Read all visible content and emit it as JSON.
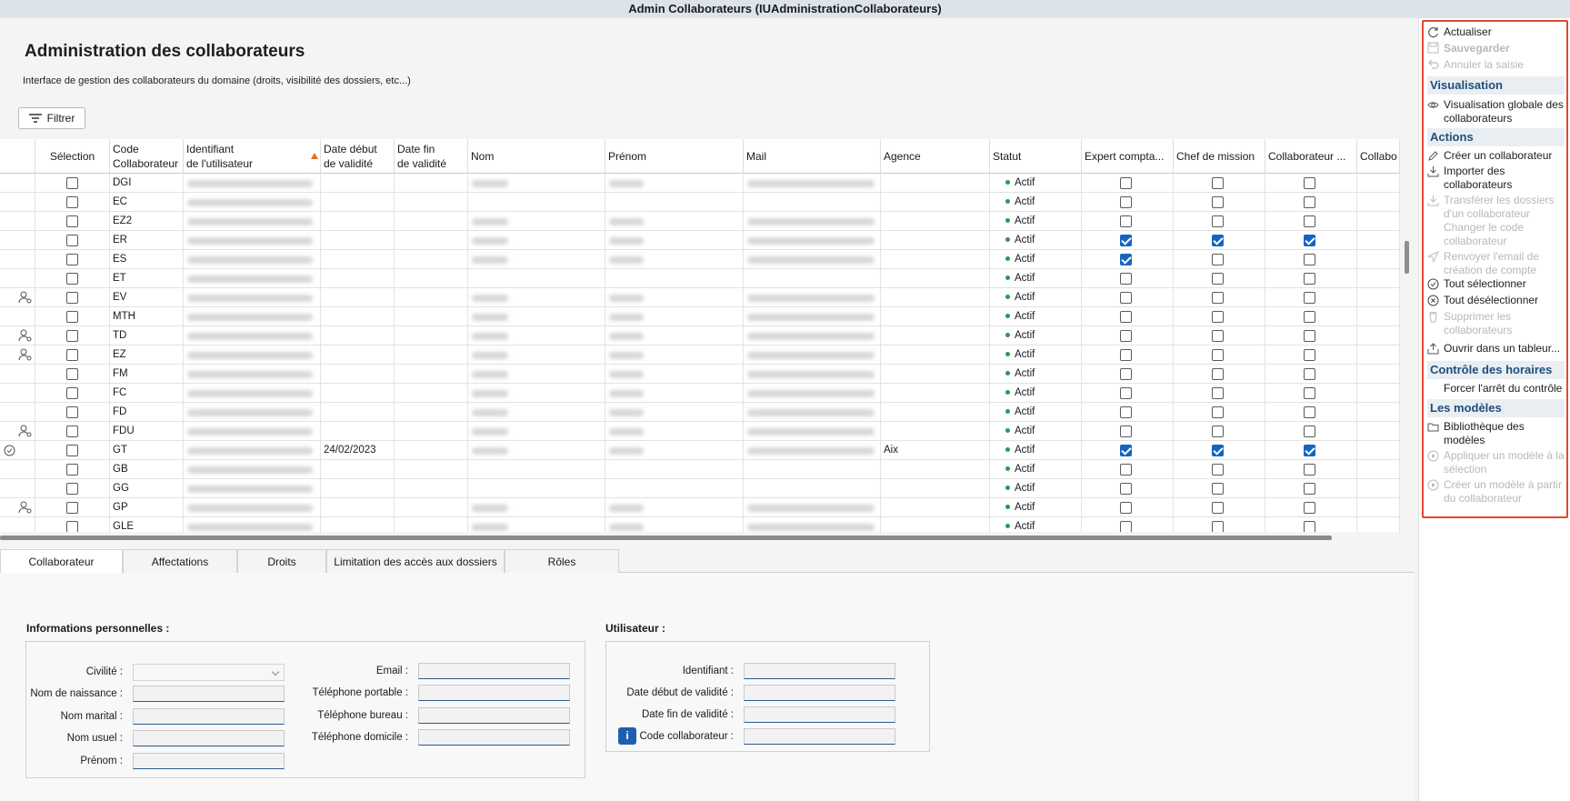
{
  "window_title": "Admin Collaborateurs (IUAdministrationCollaborateurs)",
  "page": {
    "title": "Administration des collaborateurs",
    "subtitle": "Interface de gestion des collaborateurs du domaine (droits, visibilité des dossiers, etc...)",
    "filter_label": "Filtrer"
  },
  "grid": {
    "headers": {
      "selection": "Sélection",
      "code": [
        "Code",
        "Collaborateur"
      ],
      "identifiant": [
        "Identifiant",
        "de l'utilisateur"
      ],
      "debut": [
        "Date début",
        "de validité"
      ],
      "fin": [
        "Date fin",
        "de validité"
      ],
      "nom": "Nom",
      "prenom": "Prénom",
      "mail": "Mail",
      "agence": "Agence",
      "statut": "Statut",
      "expert": "Expert compta...",
      "chef": "Chef de mission",
      "collab": "Collaborateur ...",
      "collab2": "Collabo"
    },
    "rows": [
      {
        "code": "DGI",
        "icon": "",
        "debut": "",
        "agence": "",
        "statut": "Actif",
        "expert": false,
        "chef": false,
        "collab": false
      },
      {
        "code": "EC",
        "icon": "",
        "debut": "",
        "agence": "",
        "statut": "Actif",
        "expert": false,
        "chef": false,
        "collab": false
      },
      {
        "code": "EZ2",
        "icon": "",
        "debut": "",
        "agence": "",
        "statut": "Actif",
        "expert": false,
        "chef": false,
        "collab": false
      },
      {
        "code": "ER",
        "icon": "",
        "debut": "",
        "agence": "",
        "statut": "Actif",
        "expert": true,
        "chef": true,
        "collab": true
      },
      {
        "code": "ES",
        "icon": "",
        "debut": "",
        "agence": "",
        "statut": "Actif",
        "expert": true,
        "chef": false,
        "collab": false
      },
      {
        "code": "ET",
        "icon": "",
        "debut": "",
        "agence": "",
        "statut": "Actif",
        "expert": false,
        "chef": false,
        "collab": false
      },
      {
        "code": "EV",
        "icon": "user",
        "debut": "",
        "agence": "",
        "statut": "Actif",
        "expert": false,
        "chef": false,
        "collab": false
      },
      {
        "code": "MTH",
        "icon": "",
        "debut": "",
        "agence": "",
        "statut": "Actif",
        "expert": false,
        "chef": false,
        "collab": false
      },
      {
        "code": "TD",
        "icon": "user",
        "debut": "",
        "agence": "",
        "statut": "Actif",
        "expert": false,
        "chef": false,
        "collab": false
      },
      {
        "code": "EZ",
        "icon": "user",
        "debut": "",
        "agence": "",
        "statut": "Actif",
        "expert": false,
        "chef": false,
        "collab": false
      },
      {
        "code": "FM",
        "icon": "",
        "debut": "",
        "agence": "",
        "statut": "Actif",
        "expert": false,
        "chef": false,
        "collab": false
      },
      {
        "code": "FC",
        "icon": "",
        "debut": "",
        "agence": "",
        "statut": "Actif",
        "expert": false,
        "chef": false,
        "collab": false
      },
      {
        "code": "FD",
        "icon": "",
        "debut": "",
        "agence": "",
        "statut": "Actif",
        "expert": false,
        "chef": false,
        "collab": false
      },
      {
        "code": "FDU",
        "icon": "user",
        "debut": "",
        "agence": "",
        "statut": "Actif",
        "expert": false,
        "chef": false,
        "collab": false
      },
      {
        "code": "GT",
        "icon": "check",
        "debut": "24/02/2023",
        "agence": "Aix",
        "statut": "Actif",
        "expert": true,
        "chef": true,
        "collab": true
      },
      {
        "code": "GB",
        "icon": "",
        "debut": "",
        "agence": "",
        "statut": "Actif",
        "expert": false,
        "chef": false,
        "collab": false
      },
      {
        "code": "GG",
        "icon": "",
        "debut": "",
        "agence": "",
        "statut": "Actif",
        "expert": false,
        "chef": false,
        "collab": false
      },
      {
        "code": "GP",
        "icon": "user",
        "debut": "",
        "agence": "",
        "statut": "Actif",
        "expert": false,
        "chef": false,
        "collab": false
      },
      {
        "code": "GLE",
        "icon": "",
        "debut": "",
        "agence": "",
        "statut": "Actif",
        "expert": false,
        "chef": false,
        "collab": false
      }
    ]
  },
  "tabs": [
    "Collaborateur",
    "Affectations",
    "Droits",
    "Limitation des accès aux dossiers",
    "Rôles"
  ],
  "form": {
    "personal_title": "Informations personnelles :",
    "user_title": "Utilisateur :",
    "civilite": "Civilité :",
    "nom_naissance": "Nom de naissance :",
    "nom_marital": "Nom marital :",
    "nom_usuel": "Nom usuel :",
    "prenom": "Prénom :",
    "email": "Email :",
    "tel_portable": "Téléphone portable :",
    "tel_bureau": "Téléphone bureau :",
    "tel_domicile": "Téléphone domicile :",
    "identifiant": "Identifiant :",
    "date_debut": "Date début de validité :",
    "date_fin": "Date fin de validité :",
    "code_collab": "Code collaborateur :"
  },
  "side": {
    "actualiser": "Actualiser",
    "sauvegarder": "Sauvegarder",
    "annuler": "Annuler la saisie",
    "visualisation_head": "Visualisation",
    "visu_globale": [
      "Visualisation globale des",
      "collaborateurs"
    ],
    "actions_head": "Actions",
    "creer": "Créer un collaborateur",
    "importer": [
      "Importer des",
      "collaborateurs"
    ],
    "transferer": [
      "Transférer les dossiers",
      "d'un collaborateur"
    ],
    "changer_code": [
      "Changer le code",
      "collaborateur"
    ],
    "renvoyer": [
      "Renvoyer l'email de",
      "création de compte"
    ],
    "tout_sel": "Tout sélectionner",
    "tout_desel": "Tout désélectionner",
    "supprimer": [
      "Supprimer les",
      "collaborateurs"
    ],
    "ouvrir": "Ouvrir dans un tableur...",
    "controle_head": "Contrôle des horaires",
    "forcer": "Forcer l'arrêt du contrôle",
    "modeles_head": "Les modèles",
    "bibliotheque": [
      "Bibliothèque des",
      "modèles"
    ],
    "appliquer": [
      "Appliquer un modèle à la",
      "sélection"
    ],
    "creer_modele": [
      "Créer un modèle à partir",
      "du collaborateur"
    ]
  }
}
